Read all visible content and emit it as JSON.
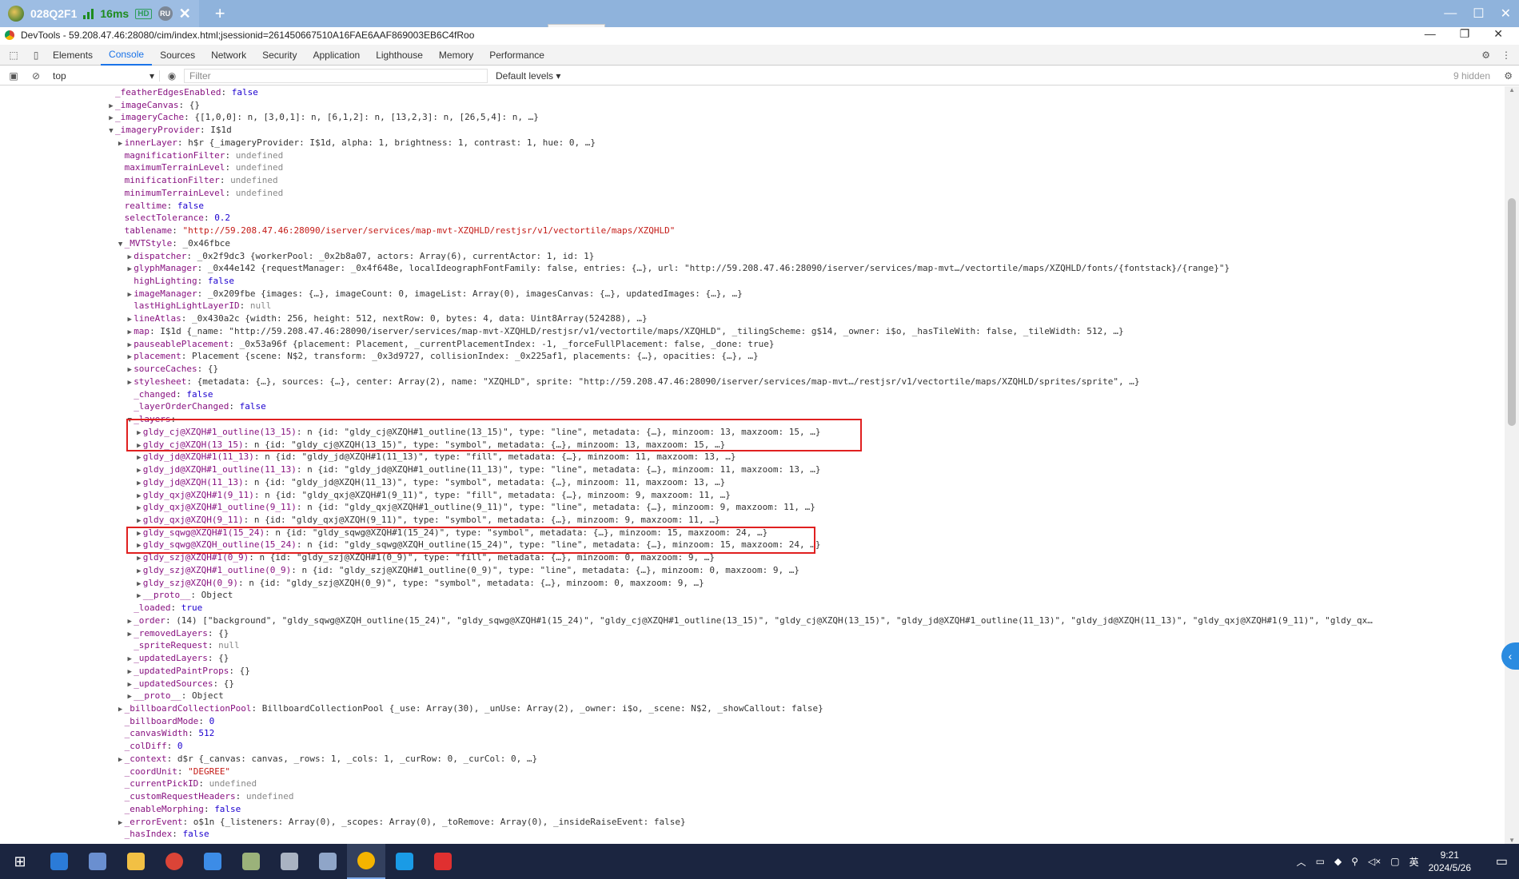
{
  "remote_session": {
    "tab_title": "028Q2F1",
    "latency": "16ms",
    "hd_badge": "HD",
    "user_badge": "RU"
  },
  "devtools": {
    "title": "DevTools - 59.208.47.46:28080/cim/index.html;jsessionid=261450667510A16FAE6AAF869003EB6C4fRoo",
    "tabs": [
      "Elements",
      "Console",
      "Sources",
      "Network",
      "Security",
      "Application",
      "Lighthouse",
      "Memory",
      "Performance"
    ],
    "active_tab": "Console",
    "context": "top",
    "filter_placeholder": "Filter",
    "levels": "Default levels ▾",
    "hidden_count": "9 hidden"
  },
  "console_lines": [
    {
      "indent": 1,
      "arrow": "",
      "key": "_featherEdgesEnabled",
      "value": "false",
      "vclass": "n"
    },
    {
      "indent": 1,
      "arrow": "▶",
      "key": "_imageCanvas",
      "value": "{}",
      "vclass": "o"
    },
    {
      "indent": 1,
      "arrow": "▶",
      "key": "_imageryCache",
      "value": "{[1,0,0]: n, [3,0,1]: n, [6,1,2]: n, [13,2,3]: n, [26,5,4]: n, …}",
      "vclass": "o"
    },
    {
      "indent": 1,
      "arrow": "▼",
      "key": "_imageryProvider",
      "value": "I$1d",
      "vclass": "o"
    },
    {
      "indent": 2,
      "arrow": "▶",
      "key": "innerLayer",
      "value": "h$r {_imageryProvider: I$1d, alpha: 1, brightness: 1, contrast: 1, hue: 0, …}",
      "vclass": "o"
    },
    {
      "indent": 2,
      "arrow": "",
      "key": "magnificationFilter",
      "value": "undefined",
      "vclass": "dim"
    },
    {
      "indent": 2,
      "arrow": "",
      "key": "maximumTerrainLevel",
      "value": "undefined",
      "vclass": "dim"
    },
    {
      "indent": 2,
      "arrow": "",
      "key": "minificationFilter",
      "value": "undefined",
      "vclass": "dim"
    },
    {
      "indent": 2,
      "arrow": "",
      "key": "minimumTerrainLevel",
      "value": "undefined",
      "vclass": "dim"
    },
    {
      "indent": 2,
      "arrow": "",
      "key": "realtime",
      "value": "false",
      "vclass": "n"
    },
    {
      "indent": 2,
      "arrow": "",
      "key": "selectTolerance",
      "value": "0.2",
      "vclass": "n"
    },
    {
      "indent": 2,
      "arrow": "",
      "key": "tablename",
      "value": "\"http://59.208.47.46:28090/iserver/services/map-mvt-XZQHLD/restjsr/v1/vectortile/maps/XZQHLD\"",
      "vclass": "s"
    },
    {
      "indent": 2,
      "arrow": "▼",
      "key": "_MVTStyle",
      "value": "_0x46fbce",
      "vclass": "o"
    },
    {
      "indent": 3,
      "arrow": "▶",
      "key": "dispatcher",
      "value": "_0x2f9dc3 {workerPool: _0x2b8a07, actors: Array(6), currentActor: 1, id: 1}",
      "vclass": "o"
    },
    {
      "indent": 3,
      "arrow": "▶",
      "key": "glyphManager",
      "value": "_0x44e142 {requestManager: _0x4f648e, localIdeographFontFamily: false, entries: {…}, url: \"http://59.208.47.46:28090/iserver/services/map-mvt…/vectortile/maps/XZQHLD/fonts/{fontstack}/{range}\"}",
      "vclass": "o"
    },
    {
      "indent": 3,
      "arrow": "",
      "key": "highLighting",
      "value": "false",
      "vclass": "n"
    },
    {
      "indent": 3,
      "arrow": "▶",
      "key": "imageManager",
      "value": "_0x209fbe {images: {…}, imageCount: 0, imageList: Array(0), imagesCanvas: {…}, updatedImages: {…}, …}",
      "vclass": "o"
    },
    {
      "indent": 3,
      "arrow": "",
      "key": "lastHighLightLayerID",
      "value": "null",
      "vclass": "dim"
    },
    {
      "indent": 3,
      "arrow": "▶",
      "key": "lineAtlas",
      "value": "_0x430a2c {width: 256, height: 512, nextRow: 0, bytes: 4, data: Uint8Array(524288), …}",
      "vclass": "o"
    },
    {
      "indent": 3,
      "arrow": "▶",
      "key": "map",
      "value": "I$1d {_name: \"http://59.208.47.46:28090/iserver/services/map-mvt-XZQHLD/restjsr/v1/vectortile/maps/XZQHLD\", _tilingScheme: g$14, _owner: i$o, _hasTileWith: false, _tileWidth: 512, …}",
      "vclass": "o"
    },
    {
      "indent": 3,
      "arrow": "▶",
      "key": "pauseablePlacement",
      "value": "_0x53a96f {placement: Placement, _currentPlacementIndex: -1, _forceFullPlacement: false, _done: true}",
      "vclass": "o"
    },
    {
      "indent": 3,
      "arrow": "▶",
      "key": "placement",
      "value": "Placement {scene: N$2, transform: _0x3d9727, collisionIndex: _0x225af1, placements: {…}, opacities: {…}, …}",
      "vclass": "o"
    },
    {
      "indent": 3,
      "arrow": "▶",
      "key": "sourceCaches",
      "value": "{}",
      "vclass": "o"
    },
    {
      "indent": 3,
      "arrow": "▶",
      "key": "stylesheet",
      "value": "{metadata: {…}, sources: {…}, center: Array(2), name: \"XZQHLD\", sprite: \"http://59.208.47.46:28090/iserver/services/map-mvt…/restjsr/v1/vectortile/maps/XZQHLD/sprites/sprite\", …}",
      "vclass": "o"
    },
    {
      "indent": 3,
      "arrow": "",
      "key": "_changed",
      "value": "false",
      "vclass": "n"
    },
    {
      "indent": 3,
      "arrow": "",
      "key": "_layerOrderChanged",
      "value": "false",
      "vclass": "n"
    },
    {
      "indent": 3,
      "arrow": "▼",
      "key": "_layers",
      "value": "",
      "vclass": "o"
    },
    {
      "indent": 4,
      "arrow": "▶",
      "key": "gldy_cj@XZQH#1_outline(13_15)",
      "value": "n {id: \"gldy_cj@XZQH#1_outline(13_15)\", type: \"line\", metadata: {…}, minzoom: 13, maxzoom: 15, …}",
      "vclass": "o"
    },
    {
      "indent": 4,
      "arrow": "▶",
      "key": "gldy_cj@XZQH(13_15)",
      "value": "n {id: \"gldy_cj@XZQH(13_15)\", type: \"symbol\", metadata: {…}, minzoom: 13, maxzoom: 15, …}",
      "vclass": "o"
    },
    {
      "indent": 4,
      "arrow": "▶",
      "key": "gldy_jd@XZQH#1(11_13)",
      "value": "n {id: \"gldy_jd@XZQH#1(11_13)\", type: \"fill\", metadata: {…}, minzoom: 11, maxzoom: 13, …}",
      "vclass": "o"
    },
    {
      "indent": 4,
      "arrow": "▶",
      "key": "gldy_jd@XZQH#1_outline(11_13)",
      "value": "n {id: \"gldy_jd@XZQH#1_outline(11_13)\", type: \"line\", metadata: {…}, minzoom: 11, maxzoom: 13, …}",
      "vclass": "o"
    },
    {
      "indent": 4,
      "arrow": "▶",
      "key": "gldy_jd@XZQH(11_13)",
      "value": "n {id: \"gldy_jd@XZQH(11_13)\", type: \"symbol\", metadata: {…}, minzoom: 11, maxzoom: 13, …}",
      "vclass": "o"
    },
    {
      "indent": 4,
      "arrow": "▶",
      "key": "gldy_qxj@XZQH#1(9_11)",
      "value": "n {id: \"gldy_qxj@XZQH#1(9_11)\", type: \"fill\", metadata: {…}, minzoom: 9, maxzoom: 11, …}",
      "vclass": "o"
    },
    {
      "indent": 4,
      "arrow": "▶",
      "key": "gldy_qxj@XZQH#1_outline(9_11)",
      "value": "n {id: \"gldy_qxj@XZQH#1_outline(9_11)\", type: \"line\", metadata: {…}, minzoom: 9, maxzoom: 11, …}",
      "vclass": "o"
    },
    {
      "indent": 4,
      "arrow": "▶",
      "key": "gldy_qxj@XZQH(9_11)",
      "value": "n {id: \"gldy_qxj@XZQH(9_11)\", type: \"symbol\", metadata: {…}, minzoom: 9, maxzoom: 11, …}",
      "vclass": "o"
    },
    {
      "indent": 4,
      "arrow": "▶",
      "key": "gldy_sqwg@XZQH#1(15_24)",
      "value": "n {id: \"gldy_sqwg@XZQH#1(15_24)\", type: \"symbol\", metadata: {…}, minzoom: 15, maxzoom: 24, …}",
      "vclass": "o"
    },
    {
      "indent": 4,
      "arrow": "▶",
      "key": "gldy_sqwg@XZQH_outline(15_24)",
      "value": "n {id: \"gldy_sqwg@XZQH_outline(15_24)\", type: \"line\", metadata: {…}, minzoom: 15, maxzoom: 24, …}",
      "vclass": "o"
    },
    {
      "indent": 4,
      "arrow": "▶",
      "key": "gldy_szj@XZQH#1(0_9)",
      "value": "n {id: \"gldy_szj@XZQH#1(0_9)\", type: \"fill\", metadata: {…}, minzoom: 0, maxzoom: 9, …}",
      "vclass": "o"
    },
    {
      "indent": 4,
      "arrow": "▶",
      "key": "gldy_szj@XZQH#1_outline(0_9)",
      "value": "n {id: \"gldy_szj@XZQH#1_outline(0_9)\", type: \"line\", metadata: {…}, minzoom: 0, maxzoom: 9, …}",
      "vclass": "o"
    },
    {
      "indent": 4,
      "arrow": "▶",
      "key": "gldy_szj@XZQH(0_9)",
      "value": "n {id: \"gldy_szj@XZQH(0_9)\", type: \"symbol\", metadata: {…}, minzoom: 0, maxzoom: 9, …}",
      "vclass": "o"
    },
    {
      "indent": 4,
      "arrow": "▶",
      "key": "__proto__",
      "value": "Object",
      "vclass": "o"
    },
    {
      "indent": 3,
      "arrow": "",
      "key": "_loaded",
      "value": "true",
      "vclass": "n"
    },
    {
      "indent": 3,
      "arrow": "▶",
      "key": "_order",
      "value": "(14) [\"background\", \"gldy_sqwg@XZQH_outline(15_24)\", \"gldy_sqwg@XZQH#1(15_24)\", \"gldy_cj@XZQH#1_outline(13_15)\", \"gldy_cj@XZQH(13_15)\", \"gldy_jd@XZQH#1_outline(11_13)\", \"gldy_jd@XZQH(11_13)\", \"gldy_qxj@XZQH#1(9_11)\", \"gldy_qx…",
      "vclass": "o"
    },
    {
      "indent": 3,
      "arrow": "▶",
      "key": "_removedLayers",
      "value": "{}",
      "vclass": "o"
    },
    {
      "indent": 3,
      "arrow": "",
      "key": "_spriteRequest",
      "value": "null",
      "vclass": "dim"
    },
    {
      "indent": 3,
      "arrow": "▶",
      "key": "_updatedLayers",
      "value": "{}",
      "vclass": "o"
    },
    {
      "indent": 3,
      "arrow": "▶",
      "key": "_updatedPaintProps",
      "value": "{}",
      "vclass": "o"
    },
    {
      "indent": 3,
      "arrow": "▶",
      "key": "_updatedSources",
      "value": "{}",
      "vclass": "o"
    },
    {
      "indent": 3,
      "arrow": "▶",
      "key": "__proto__",
      "value": "Object",
      "vclass": "o"
    },
    {
      "indent": 2,
      "arrow": "▶",
      "key": "_billboardCollectionPool",
      "value": "BillboardCollectionPool {_use: Array(30), _unUse: Array(2), _owner: i$o, _scene: N$2, _showCallout: false}",
      "vclass": "o"
    },
    {
      "indent": 2,
      "arrow": "",
      "key": "_billboardMode",
      "value": "0",
      "vclass": "n"
    },
    {
      "indent": 2,
      "arrow": "",
      "key": "_canvasWidth",
      "value": "512",
      "vclass": "n"
    },
    {
      "indent": 2,
      "arrow": "",
      "key": "_colDiff",
      "value": "0",
      "vclass": "n"
    },
    {
      "indent": 2,
      "arrow": "▶",
      "key": "_context",
      "value": "d$r {_canvas: canvas, _rows: 1, _cols: 1, _curRow: 0, _curCol: 0, …}",
      "vclass": "o"
    },
    {
      "indent": 2,
      "arrow": "",
      "key": "_coordUnit",
      "value": "\"DEGREE\"",
      "vclass": "s"
    },
    {
      "indent": 2,
      "arrow": "",
      "key": "_currentPickID",
      "value": "undefined",
      "vclass": "dim"
    },
    {
      "indent": 2,
      "arrow": "",
      "key": "_customRequestHeaders",
      "value": "undefined",
      "vclass": "dim"
    },
    {
      "indent": 2,
      "arrow": "",
      "key": "_enableMorphing",
      "value": "false",
      "vclass": "n"
    },
    {
      "indent": 2,
      "arrow": "▶",
      "key": "_errorEvent",
      "value": "o$1n {_listeners: Array(0), _scopes: Array(0), _toRemove: Array(0), _insideRaiseEvent: false}",
      "vclass": "o"
    },
    {
      "indent": 2,
      "arrow": "",
      "key": "_hasIndex",
      "value": "false",
      "vclass": "n"
    }
  ],
  "taskbar": {
    "time": "9:21",
    "date": "2024/5/26",
    "ime": "英"
  }
}
